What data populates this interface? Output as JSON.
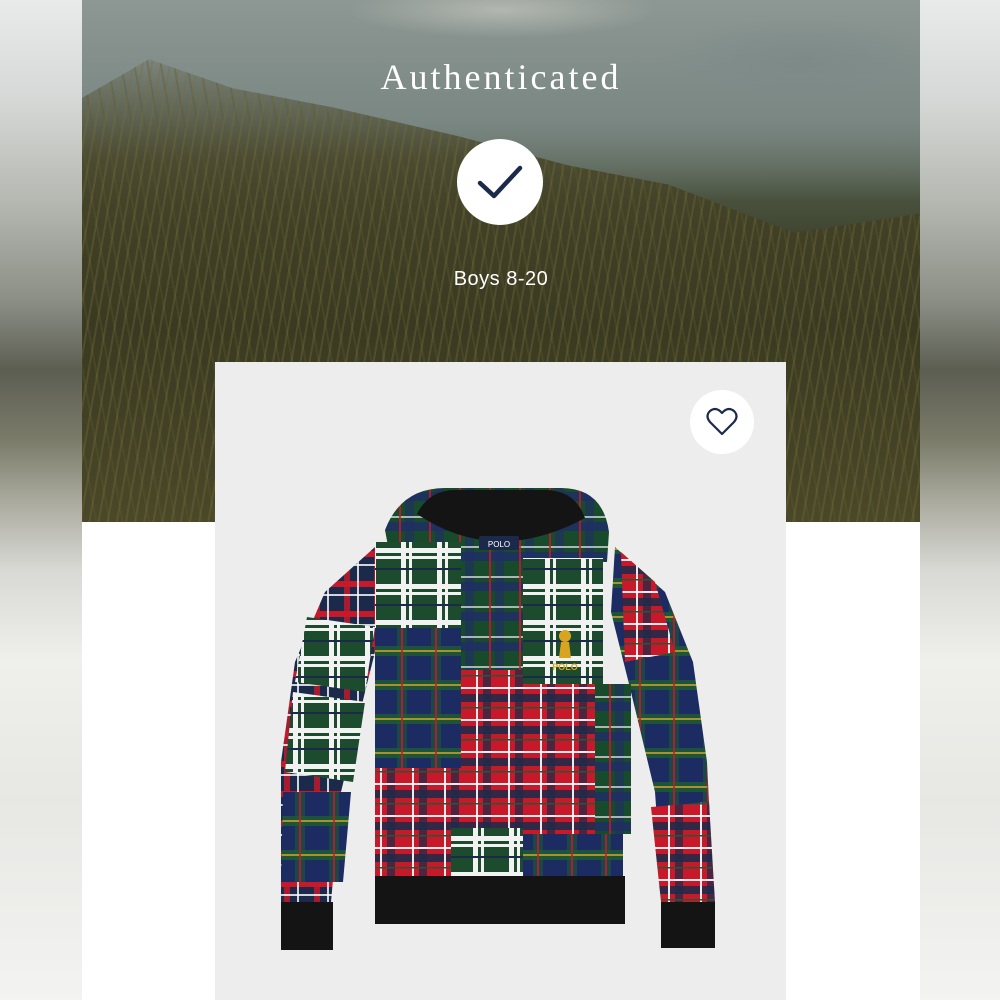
{
  "hero": {
    "title": "Authenticated",
    "category": "Boys 8-20"
  },
  "product": {
    "icon": "heart-icon",
    "badge_icon": "check-icon",
    "chest_logo": "POLO",
    "collar_label": "POLO"
  },
  "colors": {
    "navy": "#1b2a4a",
    "red": "#c8192b",
    "green": "#1f5a34",
    "white": "#f2f2f2"
  }
}
